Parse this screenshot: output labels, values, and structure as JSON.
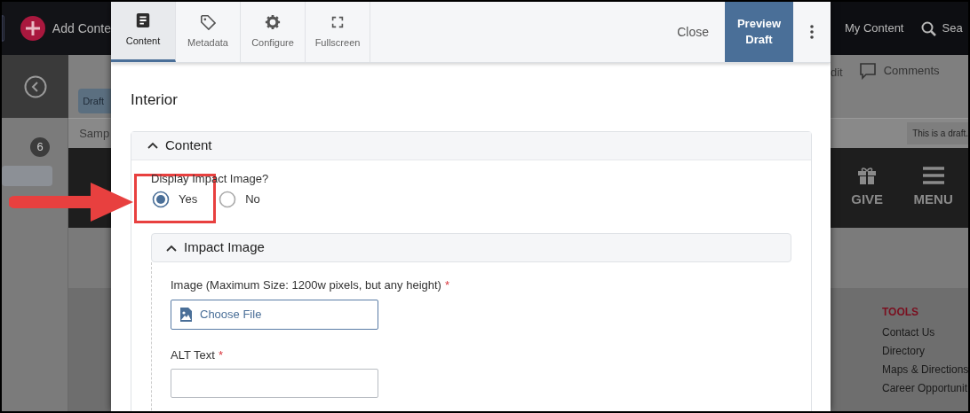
{
  "app_bar": {
    "add_content": "Add Conte",
    "my_content": "My Content",
    "search": "Sea"
  },
  "background_page": {
    "status_chip": "Draft",
    "title_fragment": "Samp",
    "badge": "6",
    "edit_fragment": "dit",
    "comments": "Comments",
    "draft_notice": "This is a draft.",
    "give": "GIVE",
    "menu": "MENU",
    "tools": {
      "heading": "TOOLS",
      "links": [
        "Contact Us",
        "Directory",
        "Maps & Directions",
        "Career Opportunit"
      ]
    }
  },
  "editor": {
    "tabs": [
      {
        "label": "Content",
        "kind": "content",
        "selected": true
      },
      {
        "label": "Metadata",
        "kind": "metadata",
        "selected": false
      },
      {
        "label": "Configure",
        "kind": "configure",
        "selected": false
      },
      {
        "label": "Fullscreen",
        "kind": "fullscreen",
        "selected": false
      }
    ],
    "close": "Close",
    "preview": "Preview Draft",
    "title": "Interior",
    "section": {
      "title": "Content",
      "expanded": true,
      "question": "Display Impact Image?",
      "options": [
        {
          "label": "Yes",
          "selected": true
        },
        {
          "label": "No",
          "selected": false
        }
      ],
      "subsection": {
        "title": "Impact Image",
        "expanded": true,
        "fields": [
          {
            "kind": "file",
            "label": "Image (Maximum Size: 1200w pixels, but any height)",
            "required_mark": "*",
            "button": "Choose File"
          },
          {
            "kind": "text",
            "label": "ALT Text",
            "required_mark": "*"
          }
        ]
      }
    }
  }
}
